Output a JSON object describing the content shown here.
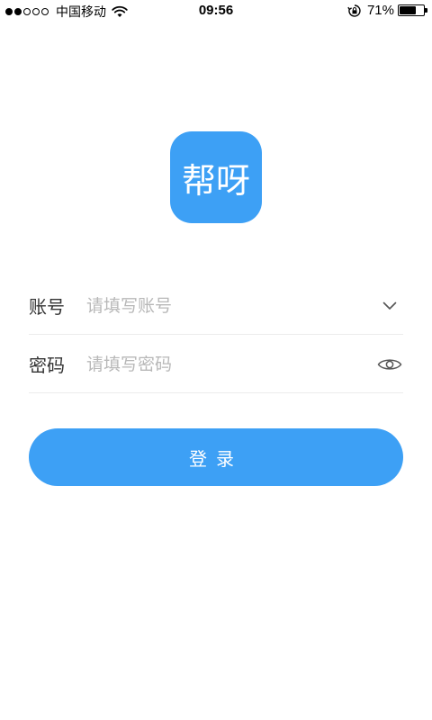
{
  "status_bar": {
    "carrier": "中国移动",
    "time": "09:56",
    "battery_percent": "71%",
    "battery_level": 0.71,
    "signal_bars_filled": 2,
    "signal_bars_total": 5
  },
  "app": {
    "logo_text_part1": "帮",
    "logo_text_part2": "呀",
    "brand_color": "#3da0f5",
    "accent_color": "#f4d64a"
  },
  "form": {
    "account": {
      "label": "账号",
      "placeholder": "请填写账号",
      "icon": "chevron-down-icon"
    },
    "password": {
      "label": "密码",
      "placeholder": "请填写密码",
      "icon": "eye-icon"
    }
  },
  "login_button": {
    "label": "登录"
  }
}
